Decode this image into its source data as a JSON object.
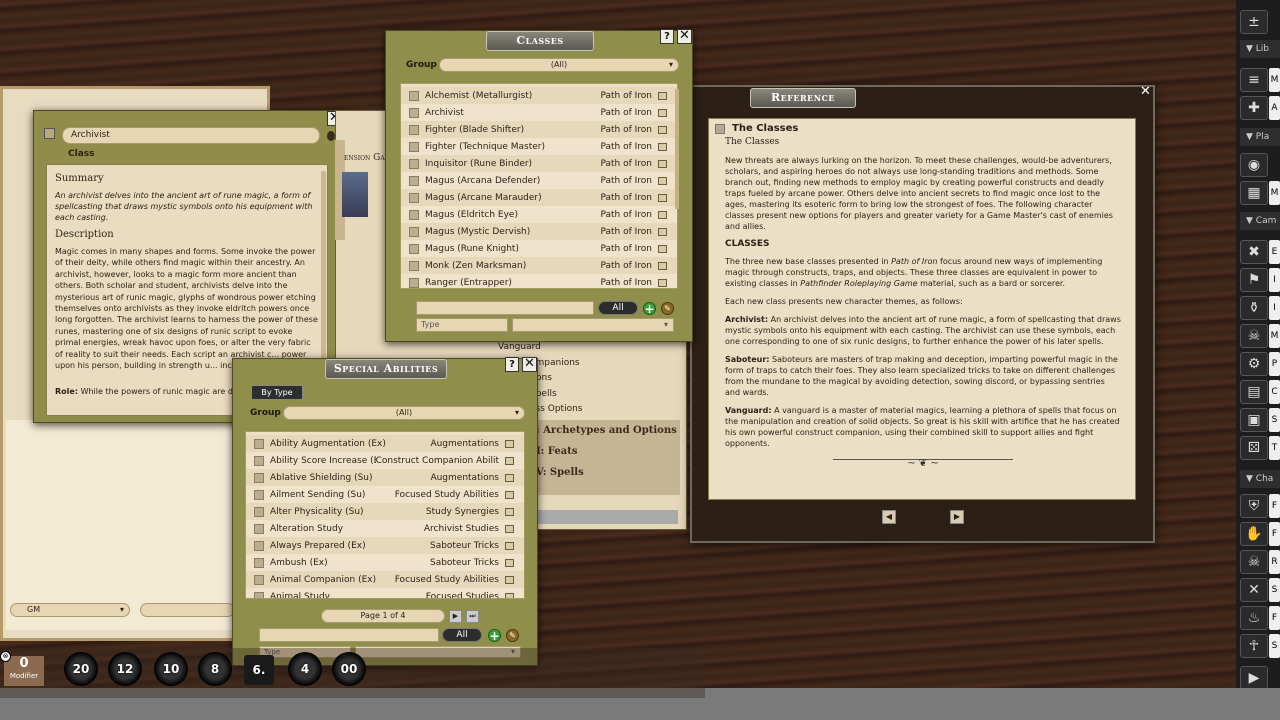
{
  "classes": {
    "title": "Classes",
    "help": "?",
    "close": "✕",
    "group_label": "Group",
    "group_value": "(All)",
    "rows": [
      {
        "name": "Alchemist (Metallurgist)",
        "source": "Path of Iron"
      },
      {
        "name": "Archivist",
        "source": "Path of Iron"
      },
      {
        "name": "Fighter (Blade Shifter)",
        "source": "Path of Iron"
      },
      {
        "name": "Fighter (Technique Master)",
        "source": "Path of Iron"
      },
      {
        "name": "Inquisitor (Rune Binder)",
        "source": "Path of Iron"
      },
      {
        "name": "Magus (Arcana Defender)",
        "source": "Path of Iron"
      },
      {
        "name": "Magus (Arcane Marauder)",
        "source": "Path of Iron"
      },
      {
        "name": "Magus (Eldritch Eye)",
        "source": "Path of Iron"
      },
      {
        "name": "Magus (Mystic Dervish)",
        "source": "Path of Iron"
      },
      {
        "name": "Magus (Rune Knight)",
        "source": "Path of Iron"
      },
      {
        "name": "Monk (Zen Marksman)",
        "source": "Path of Iron"
      },
      {
        "name": "Ranger (Entrapper)",
        "source": "Path of Iron"
      }
    ],
    "all_label": "All",
    "type_placeholder": "Type"
  },
  "archivist": {
    "name": "Archivist",
    "type_label": "Class",
    "summary_heading": "Summary",
    "summary": "An archivist delves into the ancient art of rune magic, a form of spellcasting that draws mystic symbols onto his equipment with each casting.",
    "description_heading": "Description",
    "description": "Magic comes in many shapes and forms. Some invoke the power of their deity, while others find magic within their ancestry. An archivist, however, looks to a magic form more ancient than others. Both scholar and student, archivists delve into the mysterious art of runic magic, glyphs of wondrous power etching themselves onto archivists as they invoke eldritch powers once long forgotten. The archivist learns to harness the power of these runes, mastering one of six designs of runic script to evoke primal energies, wreak havoc upon foes, or alter the very fabric of reality to suit their needs. Each script an archivist c... power upon his person, building in strength u... incredible result.",
    "role_label": "Role:",
    "role_text": "While the powers of runic magic are div..."
  },
  "background_book": {
    "header_fragment": "ension Ga",
    "items": [
      "Vanguard",
      "ompanions",
      "tions",
      "Spells",
      "ass Options"
    ],
    "chapters": [
      ": Archetypes and Options",
      "I: Feats",
      "V: Spells"
    ]
  },
  "special": {
    "title": "Special Abilities",
    "help": "?",
    "close": "✕",
    "by_type": "By Type",
    "group_label": "Group",
    "group_value": "(All)",
    "rows": [
      {
        "name": "Ability Augmentation (Ex)",
        "source": "Augmentations"
      },
      {
        "name": "Ability Score Increase (Ex)",
        "source": "Construct Companion Abilit"
      },
      {
        "name": "Ablative Shielding (Su)",
        "source": "Augmentations"
      },
      {
        "name": "Ailment Sending (Su)",
        "source": "Focused Study Abilities"
      },
      {
        "name": "Alter Physicality (Su)",
        "source": "Study Synergies"
      },
      {
        "name": "Alteration Study",
        "source": "Archivist Studies"
      },
      {
        "name": "Always Prepared (Ex)",
        "source": "Saboteur Tricks"
      },
      {
        "name": "Ambush (Ex)",
        "source": "Saboteur Tricks"
      },
      {
        "name": "Animal Companion (Ex)",
        "source": "Focused Study Abilities"
      },
      {
        "name": "Animal Study",
        "source": "Focused Studies"
      }
    ],
    "page_label": "Page 1 of 4",
    "all_label": "All",
    "type_placeholder": "Type"
  },
  "reference": {
    "title": "Reference",
    "close": "✕",
    "heading": "The Classes",
    "subheading": "The Classes",
    "p1": "New threats are always lurking on the horizon. To meet these challenges, would-be adventurers, scholars, and aspiring heroes do not always use long-standing traditions and methods. Some branch out, finding new methods to employ magic by creating powerful constructs and deadly traps fueled by arcane power. Others delve into ancient secrets to find magic once lost to the ages, mastering its esoteric form to bring low the strongest of foes. The following character classes present new options for players and greater variety for a Game Master's cast of enemies and allies.",
    "classes_heading": "CLASSES",
    "p2_a": "The three new base classes presented in ",
    "p2_em1": "Path of Iron",
    "p2_b": " focus around new ways of implementing magic through constructs, traps, and objects. These three classes are equivalent in power to existing classes in ",
    "p2_em2": "Pathfinder Roleplaying Game",
    "p2_c": " material, such as a bard or sorcerer.",
    "p3": "Each new class presents new character themes, as follows:",
    "archivist_label": "Archivist:",
    "archivist_text": " An archivist delves into the ancient art of rune magic, a form of spellcasting that draws mystic symbols onto his equipment with each casting. The archivist can use these symbols, each one corresponding to one of six runic designs, to further enhance the power of his later spells.",
    "saboteur_label": "Saboteur:",
    "saboteur_text": " Saboteurs are masters of trap making and deception, imparting powerful magic in the form of traps to catch their foes. They also learn specialized tricks to take on different challenges from the mundane to the magical by avoiding detection, sowing discord, or bypassing sentries and wards.",
    "vanguard_label": "Vanguard:",
    "vanguard_text": " A vanguard is a master of material magics, learning a plethora of spells that focus on the manipulation and creation of solid objects. So great is his skill with artifice that he has created his own powerful construct companion, using their combined skill to support allies and fight opponents."
  },
  "chat": {
    "identity": "GM"
  },
  "modifier": {
    "value": "0",
    "label": "Modifier"
  },
  "dice": [
    {
      "label": "20",
      "icon": "d20-icon"
    },
    {
      "label": "12",
      "icon": "d12-icon"
    },
    {
      "label": "10",
      "icon": "d10-icon"
    },
    {
      "label": "8",
      "icon": "d8-icon"
    },
    {
      "label": "6.",
      "icon": "d6-icon"
    },
    {
      "label": "4",
      "icon": "d4-icon"
    },
    {
      "label": "00",
      "icon": "d100-icon"
    }
  ],
  "sidebar": {
    "sections": [
      "Lib",
      "Pla",
      "Cam",
      "Cha"
    ],
    "side_letters": [
      "M",
      "A",
      "",
      "M",
      "E",
      "I",
      "I",
      "M",
      "P",
      "C",
      "S",
      "T",
      "F",
      "F",
      "R",
      "S",
      "F",
      "S"
    ]
  }
}
